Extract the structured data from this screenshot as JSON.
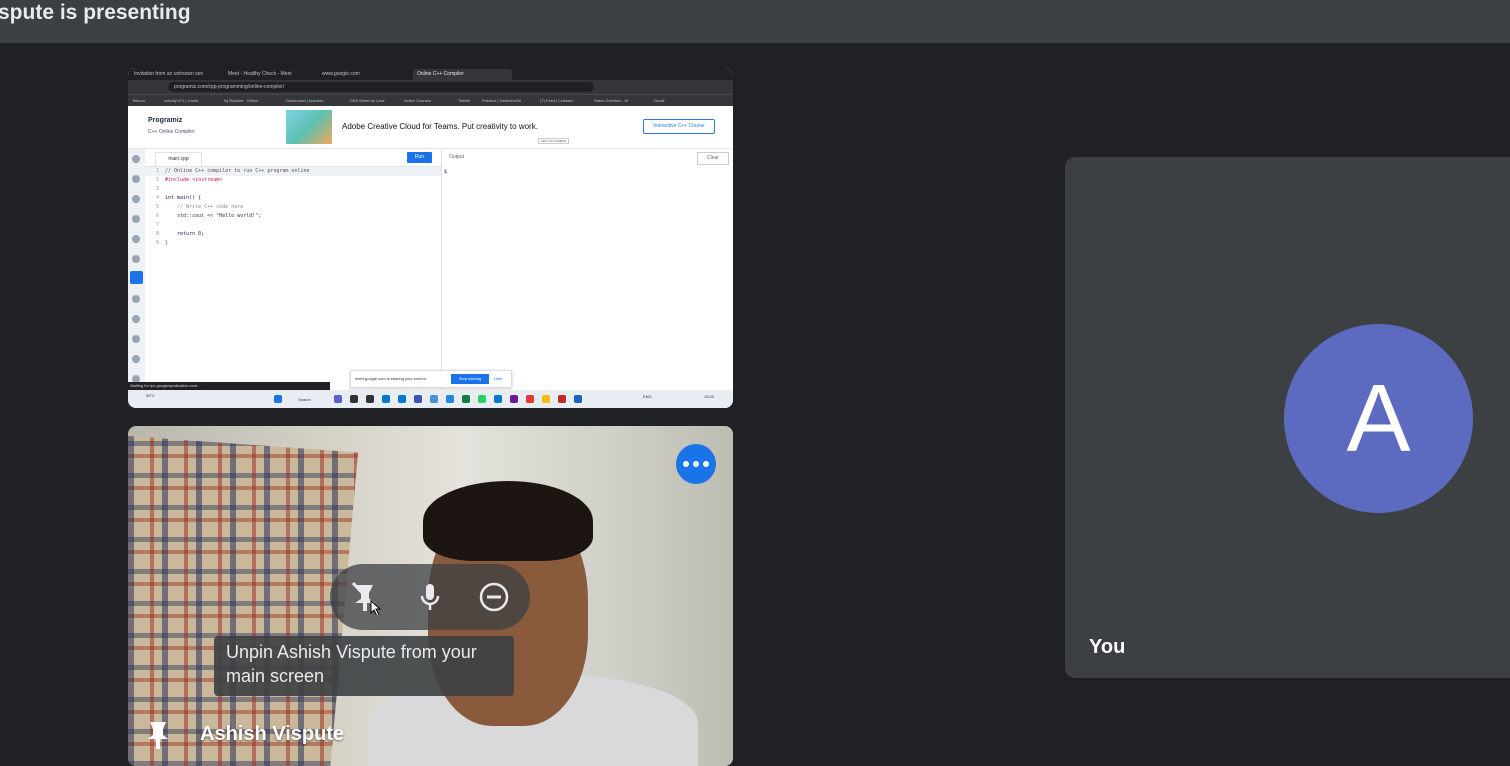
{
  "header": {
    "title": "spute is presenting"
  },
  "shared_screen": {
    "browser_tabs": [
      "Invitation from an unknown sen",
      "Meet - Healthy Check - Meet",
      "www.google.com",
      "Online C++ Compiler"
    ],
    "url": "programiz.com/cpp-programming/online-compiler/",
    "bookmarks": [
      "Telenor",
      "zchody.071 | Cadet",
      "Inj Replant · Girlfco",
      "Dashboard | Academ",
      "DSA Sheet by Love",
      "Active Courses",
      "TelBelt",
      "Practice | GeeksforGe",
      "(7) Feed | LinkedIn",
      "Stack Overflow - W",
      "Gmail"
    ],
    "site": {
      "logo": "Programiz",
      "subtitle": "C++ Online Compiler",
      "ad_text": "Adobe Creative Cloud for Teams. Put creativity to work.",
      "ad_button": "Interactive C++ Course",
      "ad_tag": "ADS VIA CARBON"
    },
    "editor": {
      "file_tab": "main.cpp",
      "run_label": "Run",
      "lines": [
        {
          "n": "1",
          "text": "// Online C++ compiler to run C++ program online"
        },
        {
          "n": "2",
          "text": "#include <iostream>"
        },
        {
          "n": "3",
          "text": ""
        },
        {
          "n": "4",
          "text": "int main() {"
        },
        {
          "n": "5",
          "text": "    // Write C++ code here"
        },
        {
          "n": "6",
          "text": "    std::cout << \"Hello world!\";"
        },
        {
          "n": "7",
          "text": ""
        },
        {
          "n": "8",
          "text": "    return 0;"
        },
        {
          "n": "9",
          "text": "}"
        }
      ]
    },
    "output": {
      "label": "Output",
      "clear_label": "Clear",
      "line": "$"
    },
    "share_bar": {
      "message": "meet.google.com is sharing your screen.",
      "stop_label": "Stop sharing",
      "hide_label": "Hide"
    },
    "status_text": "Waiting for tpc.googlesyndication.com...",
    "taskbar": {
      "weather": "30°C",
      "search": "Search",
      "lang": "ENG",
      "time": "15:00"
    }
  },
  "camera_tile": {
    "participant_name": "Ashish Vispute",
    "tooltip": "Unpin Ashish Vispute from your main screen",
    "colors": {
      "more_button": "#1a73e8"
    }
  },
  "self_tile": {
    "avatar_letter": "A",
    "label": "You",
    "colors": {
      "avatar": "#5c6bc0"
    }
  }
}
